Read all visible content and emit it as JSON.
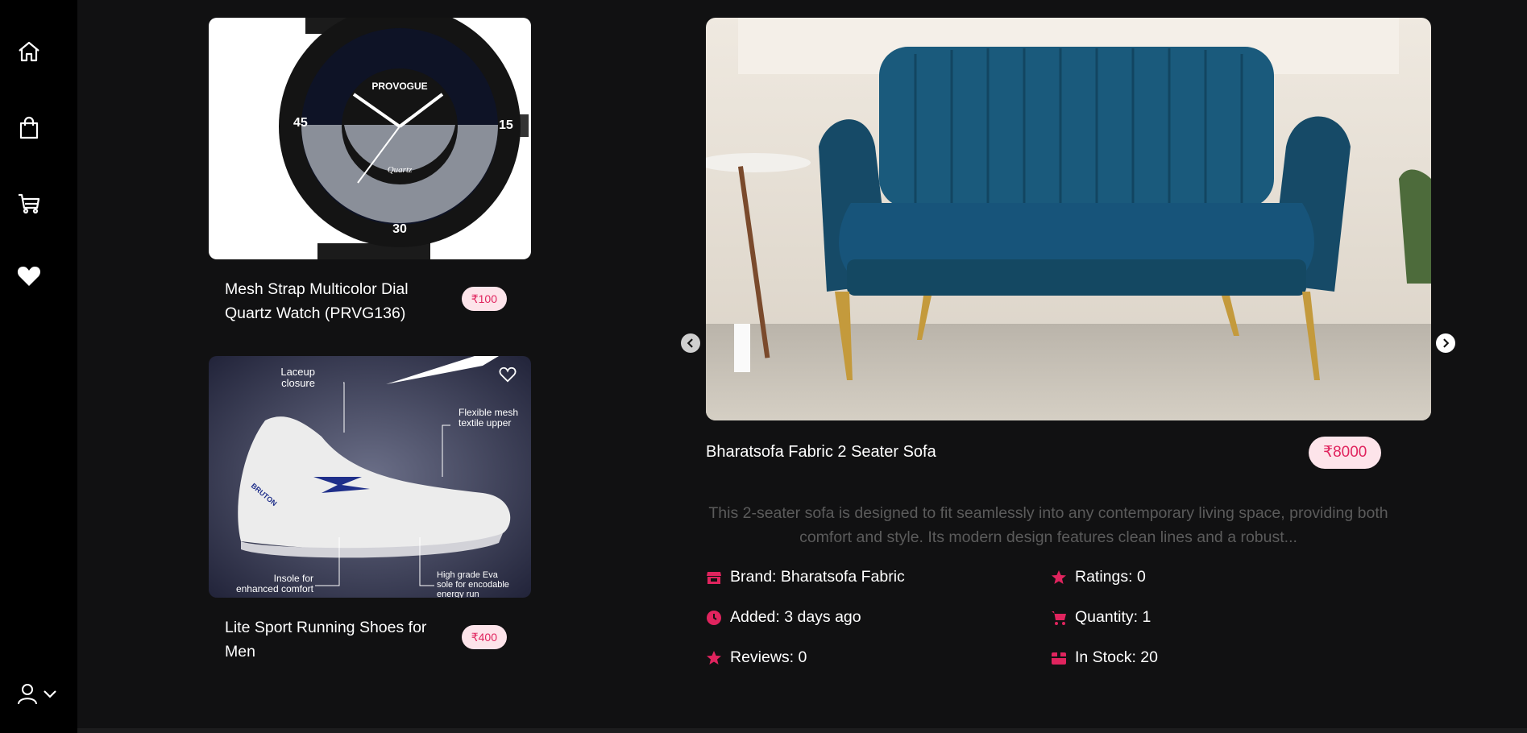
{
  "sidebar": {
    "items": [
      {
        "name": "home-icon"
      },
      {
        "name": "shopping-bag-icon"
      },
      {
        "name": "cart-icon"
      },
      {
        "name": "heart-icon"
      }
    ],
    "profile_icon": "user-icon",
    "dropdown_icon": "chevron-down-icon"
  },
  "products": [
    {
      "title": "Mesh Strap Multicolor Dial Quartz Watch (PRVG136)",
      "price": "₹100",
      "image_text": {
        "brand": "PROVOGUE",
        "dial": "Quartz",
        "n45": "45",
        "n15": "15",
        "n30": "30"
      }
    },
    {
      "title": "Lite Sport Running Shoes for Men",
      "price": "₹400",
      "image_text": {
        "laceup": [
          "Laceup",
          "closure"
        ],
        "mesh": [
          "Flexible mesh",
          "textile upper"
        ],
        "insole": [
          "Insole for",
          "enhanced comfort"
        ],
        "eva": [
          "High grade Eva",
          "sole for encodable",
          "energy run"
        ],
        "logo": "BRUTON"
      }
    }
  ],
  "featured": {
    "title": "Bharatsofa Fabric 2 Seater Sofa",
    "price": "₹8000",
    "description": "This 2-seater sofa is designed to fit seamlessly into any contemporary living space, providing both comfort and style. Its modern design features clean lines and a robust...",
    "meta": {
      "brand": "Brand: Bharatsofa Fabric",
      "ratings": "Ratings: 0",
      "added": "Added: 3 days ago",
      "quantity": "Quantity: 1",
      "reviews": "Reviews: 0",
      "stock": "In Stock: 20"
    }
  },
  "colors": {
    "accent": "#e0245e",
    "badge_bg": "#fde4ea",
    "background": "#111112",
    "sidebar": "#000000"
  }
}
